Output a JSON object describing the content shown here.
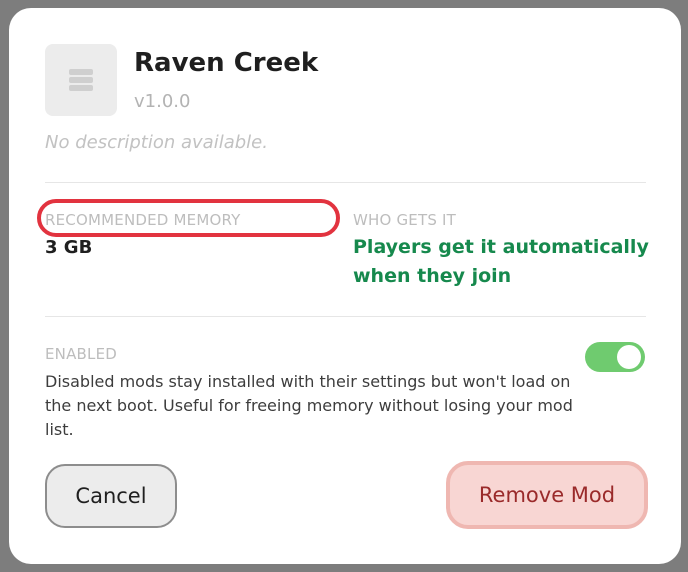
{
  "mod": {
    "icon": "layers-icon",
    "title": "Raven Creek",
    "version": "v1.0.0",
    "description": "No description available."
  },
  "memory": {
    "label": "RECOMMENDED MEMORY",
    "value": "3 GB",
    "highlight_color": "#e2333f"
  },
  "distribution": {
    "label": "WHO GETS IT",
    "value": "Players get it automatically when they join",
    "color": "#16894d"
  },
  "enabled": {
    "label": "ENABLED",
    "state": true,
    "description": "Disabled mods stay installed with their settings but won't load on the next boot. Useful for freeing memory without losing your mod list.",
    "toggle_color": "#6fcb6f"
  },
  "actions": {
    "cancel_label": "Cancel",
    "remove_label": "Remove Mod"
  }
}
